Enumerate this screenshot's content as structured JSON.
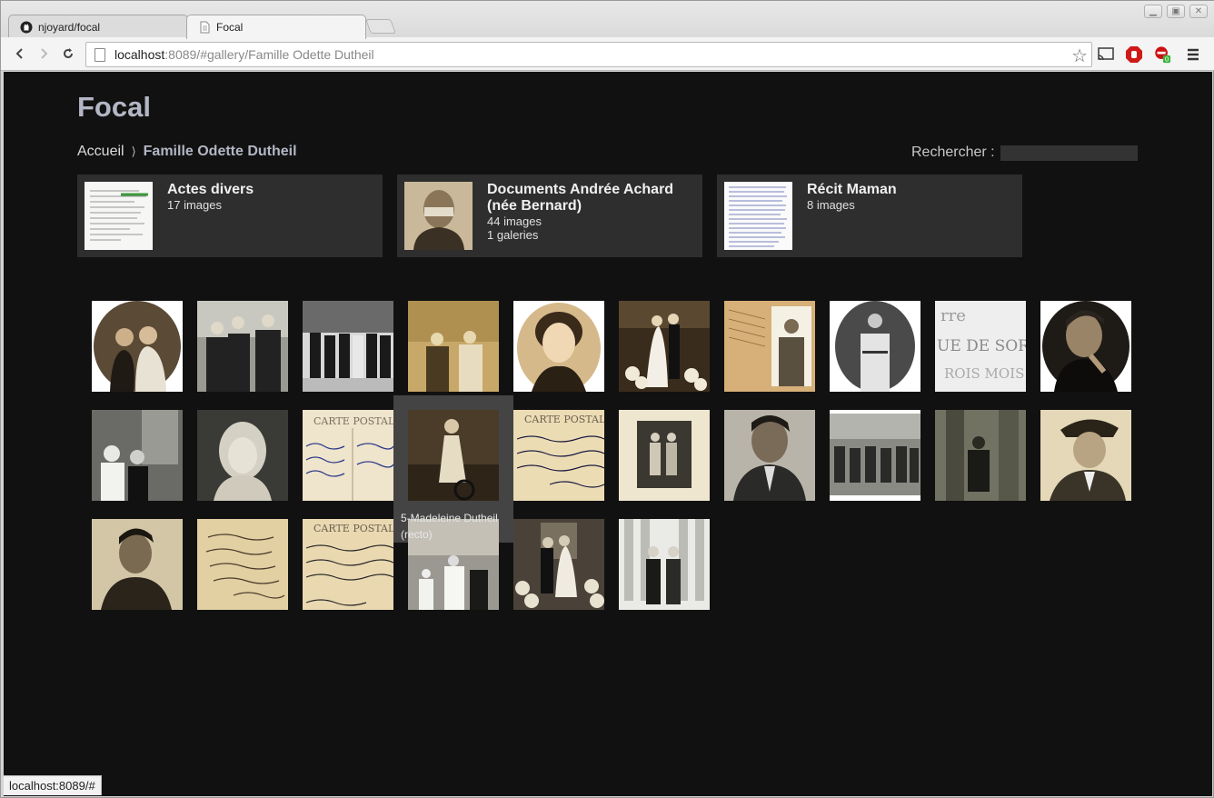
{
  "browser": {
    "tabs": [
      {
        "label": "njoyard/focal",
        "icon": "github-icon"
      },
      {
        "label": "Focal",
        "icon": "page-icon"
      }
    ],
    "url_host": "localhost",
    "url_rest": ":8089/#gallery/Famille Odette Dutheil",
    "status_url": "localhost:8089/#"
  },
  "site": {
    "title": "Focal",
    "breadcrumb": {
      "home": "Accueil",
      "separator": "⟩",
      "current": "Famille Odette Dutheil"
    },
    "search_label": "Rechercher :",
    "search_value": ""
  },
  "galleries": [
    {
      "title": "Actes divers",
      "counts": [
        "17 images"
      ]
    },
    {
      "title": "Documents Andrée Achard (née Bernard)",
      "counts": [
        "44 images",
        "1 galeries"
      ]
    },
    {
      "title": "Récit Maman",
      "counts": [
        "8 images"
      ]
    }
  ],
  "tooltip": "5-Madeleine Dutheil (recto)",
  "colors": {
    "page_bg": "#111111",
    "card_bg": "#2e2e2e",
    "title": "#b3b6c4"
  }
}
